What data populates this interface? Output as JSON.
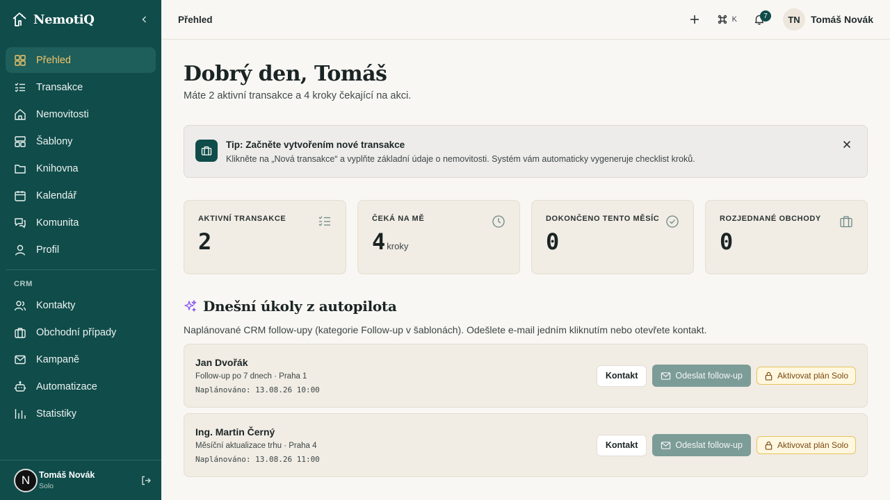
{
  "brand": {
    "name": "NemotiQ"
  },
  "sidebar": {
    "items": [
      {
        "label": "Přehled",
        "icon": "dashboard-icon"
      },
      {
        "label": "Transakce",
        "icon": "checklist-icon"
      },
      {
        "label": "Nemovitosti",
        "icon": "home-icon"
      },
      {
        "label": "Šablony",
        "icon": "template-icon"
      },
      {
        "label": "Knihovna",
        "icon": "folder-icon"
      },
      {
        "label": "Kalendář",
        "icon": "calendar-icon"
      },
      {
        "label": "Komunita",
        "icon": "chat-icon"
      },
      {
        "label": "Profil",
        "icon": "user-icon"
      }
    ],
    "crm_label": "CRM",
    "crm_items": [
      {
        "label": "Kontakty",
        "icon": "users-icon"
      },
      {
        "label": "Obchodní případy",
        "icon": "briefcase-icon"
      },
      {
        "label": "Kampaně",
        "icon": "mail-icon"
      },
      {
        "label": "Automatizace",
        "icon": "bot-icon"
      },
      {
        "label": "Statistiky",
        "icon": "bar-chart-icon"
      }
    ],
    "footer": {
      "avatar_letter": "N",
      "name": "Tomáš Novák",
      "plan": "Solo"
    }
  },
  "topbar": {
    "breadcrumb": "Přehled",
    "shortcut_key": "K",
    "notification_count": "7",
    "user_initials": "TN",
    "user_name": "Tomáš Novák"
  },
  "main": {
    "greeting": "Dobrý den, Tomáš",
    "subtitle": "Máte 2 aktivní transakce a 4 kroky čekající na akci.",
    "tip": {
      "title": "Tip: Začněte vytvořením nové transakce",
      "text": "Klikněte na „Nová transakce“ a vyplňte základní údaje o nemovitosti. Systém vám automaticky vygeneruje checklist kroků."
    },
    "stats": [
      {
        "label": "AKTIVNÍ TRANSAKCE",
        "value": "2",
        "unit": "",
        "icon": "checklist-icon"
      },
      {
        "label": "ČEKÁ NA MĚ",
        "value": "4",
        "unit": "kroky",
        "icon": "clock-icon"
      },
      {
        "label": "DOKONČENO TENTO MĚSÍC",
        "value": "0",
        "unit": "",
        "icon": "check-circle-icon"
      },
      {
        "label": "ROZJEDNANÉ OBCHODY",
        "value": "0",
        "unit": "",
        "icon": "briefcase-icon"
      }
    ],
    "autopilot": {
      "title": "Dnešní úkoly z autopilota",
      "description": "Naplánované CRM follow-upy (kategorie Follow-up v šablonách). Odešlete e-mail jedním kliknutím nebo otevřete kontakt.",
      "contact_label": "Kontakt",
      "send_label": "Odeslat follow-up",
      "upgrade_label": "Aktivovat plán Solo",
      "tasks": [
        {
          "name": "Jan Dvořák",
          "meta": "Follow-up po 7 dnech · Praha 1",
          "scheduled": "Naplánováno: 13.08.26 10:00"
        },
        {
          "name": "Ing. Martin Černý",
          "meta": "Měsíční aktualizace trhu · Praha 4",
          "scheduled": "Naplánováno: 13.08.26 11:00"
        }
      ]
    }
  },
  "colors": {
    "sidebar": "#0f4c4a",
    "accent": "#f1c66b",
    "background": "#f9f7f3"
  }
}
